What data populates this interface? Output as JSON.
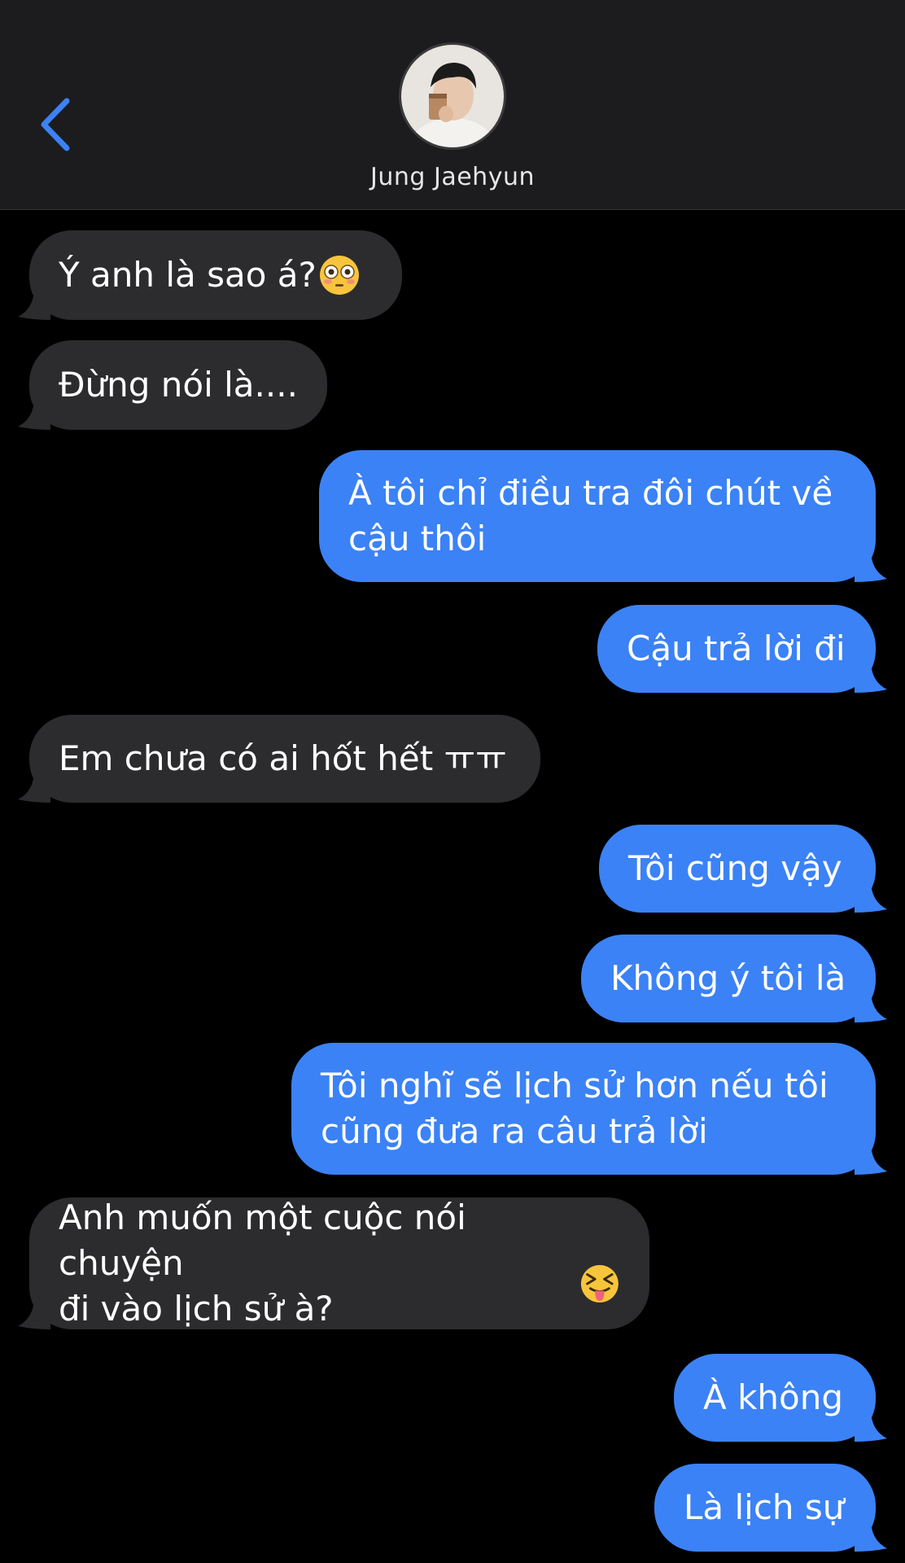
{
  "header": {
    "contact_name": "Jung Jaehyun"
  },
  "colors": {
    "incoming_bubble": "#2c2c2e",
    "outgoing_bubble": "#3b82f6",
    "back_chevron": "#3b82f6",
    "header_bg": "#1c1c1e"
  },
  "messages": [
    {
      "direction": "incoming",
      "text": "Ý anh là sao á?",
      "emoji": "flushed-face"
    },
    {
      "direction": "incoming",
      "text": "Đừng nói là...."
    },
    {
      "direction": "outgoing",
      "text": "À tôi chỉ điều tra đôi chút về\ncậu thôi"
    },
    {
      "direction": "outgoing",
      "text": "Cậu trả lời đi"
    },
    {
      "direction": "incoming",
      "text": "Em chưa có ai hốt hết ㅠㅠ"
    },
    {
      "direction": "outgoing",
      "text": "Tôi cũng vậy"
    },
    {
      "direction": "outgoing",
      "text": "Không ý tôi là"
    },
    {
      "direction": "outgoing",
      "text": "Tôi nghĩ sẽ lịch sử hơn nếu tôi\ncũng đưa ra câu trả lời"
    },
    {
      "direction": "incoming",
      "text": "Anh muốn một cuộc nói chuyện\nđi vào lịch sử à?",
      "emoji": "squinting-tongue-face"
    },
    {
      "direction": "outgoing",
      "text": "À không"
    },
    {
      "direction": "outgoing",
      "text": "Là lịch sự"
    }
  ]
}
